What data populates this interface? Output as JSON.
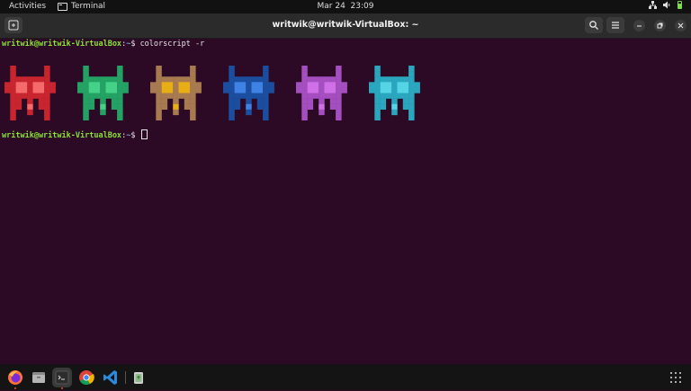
{
  "topbar": {
    "activities": "Activities",
    "app_name": "Terminal",
    "date": "Mar 24",
    "time": "23:09"
  },
  "window": {
    "title": "writwik@writwik-VirtualBox: ~"
  },
  "terminal": {
    "prompt_user": "writwik@writwik-VirtualBox",
    "prompt_path": "~",
    "command": "colorscript -r",
    "invader_colors": [
      {
        "body": "#c9252f",
        "eyes": "#f56a6a"
      },
      {
        "body": "#23a264",
        "eyes": "#45d187"
      },
      {
        "body": "#a87a50",
        "eyes": "#e8ae17"
      },
      {
        "body": "#1c4ea0",
        "eyes": "#3e82e6"
      },
      {
        "body": "#a54ec0",
        "eyes": "#d070e8"
      },
      {
        "body": "#2aa7bf",
        "eyes": "#55d4e6"
      }
    ]
  },
  "dock": {
    "apps": [
      "firefox-icon",
      "files-icon",
      "terminal-icon",
      "chrome-icon",
      "vscode-icon",
      "trash-icon"
    ],
    "accent": "#e95420"
  }
}
